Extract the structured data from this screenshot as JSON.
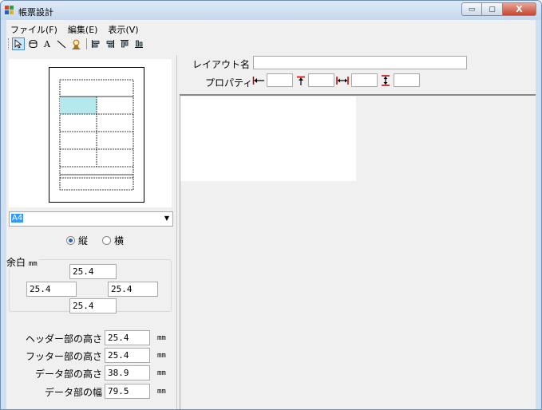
{
  "window": {
    "title": "帳票設計",
    "min_glyph": "▭",
    "max_glyph": "▢",
    "close_glyph": "X"
  },
  "menu": {
    "file": "ファイル(F)",
    "edit": "編集(E)",
    "view": "表示(V)"
  },
  "toolbar": {
    "icons": [
      "pointer-icon",
      "ellipse-icon",
      "text-icon",
      "line-icon",
      "stamp-icon",
      "align-left-icon",
      "align-right-icon",
      "align-top-icon",
      "align-bottom-icon"
    ],
    "text_glyph": "A"
  },
  "page_setup": {
    "paper_size": "A4",
    "orientation": {
      "portrait_label": "縦",
      "landscape_label": "横",
      "selected": "portrait"
    },
    "margin": {
      "title": "余白",
      "unit": "mm",
      "top": "25.4",
      "left": "25.4",
      "right": "25.4",
      "bottom": "25.4"
    },
    "dimensions": {
      "header_height_label": "ヘッダー部の高さ",
      "header_height": "25.4",
      "footer_height_label": "フッター部の高さ",
      "footer_height": "25.4",
      "data_height_label": "データ部の高さ",
      "data_height": "38.9",
      "data_width_label": "データ部の幅",
      "data_width": "79.5",
      "unit": "mm"
    }
  },
  "layout": {
    "name_label": "レイアウト名",
    "name_value": "",
    "property_label": "プロパティ",
    "property_left": "",
    "property_top": "",
    "property_width": "",
    "property_height": ""
  },
  "colors": {
    "selected_cell": "#b5e9ee",
    "title_accent": "#c4452f"
  }
}
